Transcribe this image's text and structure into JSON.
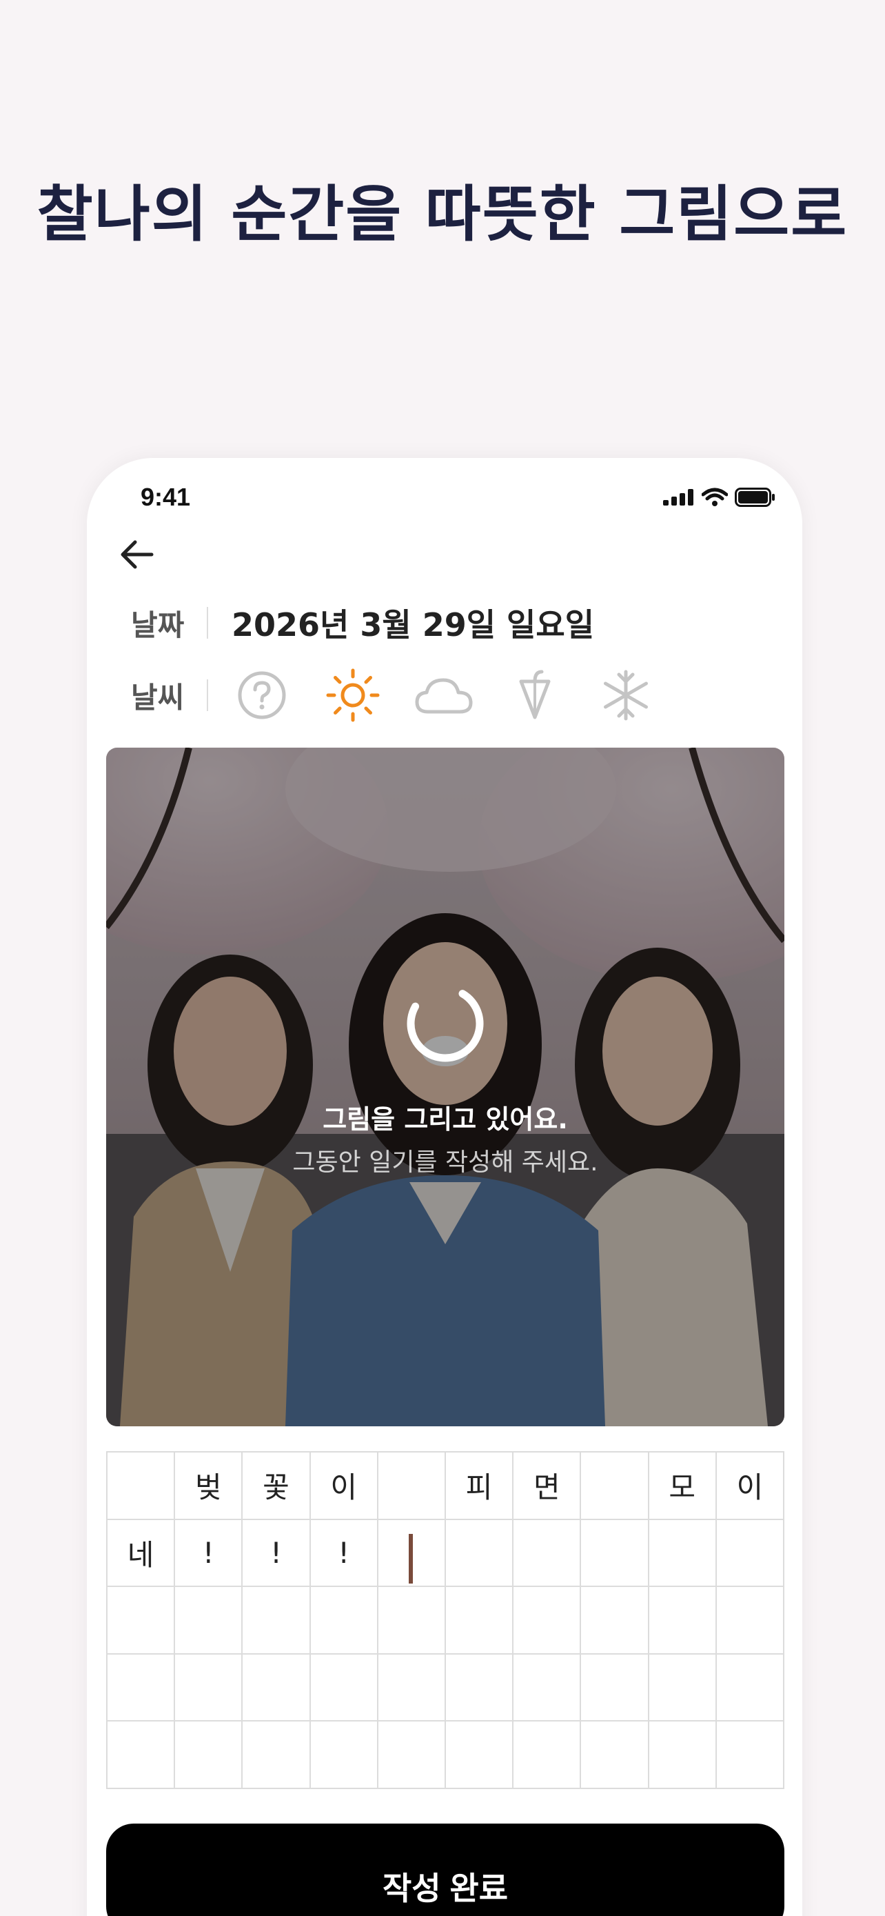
{
  "headline": "찰나의 순간을 따뜻한 그림으로",
  "status_bar": {
    "time": "9:41",
    "icons": [
      "signal-icon",
      "wifi-icon",
      "battery-icon"
    ]
  },
  "header": {
    "back_icon": "arrow-left-icon"
  },
  "date_row": {
    "label": "날짜",
    "value": "2026년 3월 29일 일요일"
  },
  "weather_row": {
    "label": "날씨",
    "options": [
      {
        "name": "unknown",
        "icon": "question-circle-icon",
        "selected": false
      },
      {
        "name": "sunny",
        "icon": "sun-icon",
        "selected": true
      },
      {
        "name": "cloudy",
        "icon": "cloud-icon",
        "selected": false
      },
      {
        "name": "rainy",
        "icon": "umbrella-icon",
        "selected": false
      },
      {
        "name": "snowy",
        "icon": "snowflake-icon",
        "selected": false
      }
    ]
  },
  "photo": {
    "loading_title": "그림을 그리고 있어요.",
    "loading_subtitle": "그동안 일기를 작성해 주세요."
  },
  "manuscript": {
    "columns": 10,
    "rows": 5,
    "cells": [
      "",
      "벚",
      "꽃",
      "이",
      "",
      "피",
      "면",
      "",
      "모",
      "이",
      "네",
      "!",
      "!",
      "!",
      "",
      "",
      "",
      "",
      "",
      "",
      "",
      "",
      "",
      "",
      "",
      "",
      "",
      "",
      "",
      "",
      "",
      "",
      "",
      "",
      "",
      "",
      "",
      "",
      "",
      "",
      "",
      "",
      "",
      "",
      "",
      "",
      "",
      "",
      "",
      ""
    ],
    "cursor_cell": 14
  },
  "submit_button": {
    "label": "작성 완료"
  },
  "colors": {
    "accent": "#f08a1c",
    "headline": "#1d2140",
    "icon_inactive": "#c4c4c4",
    "button": "#000000"
  }
}
